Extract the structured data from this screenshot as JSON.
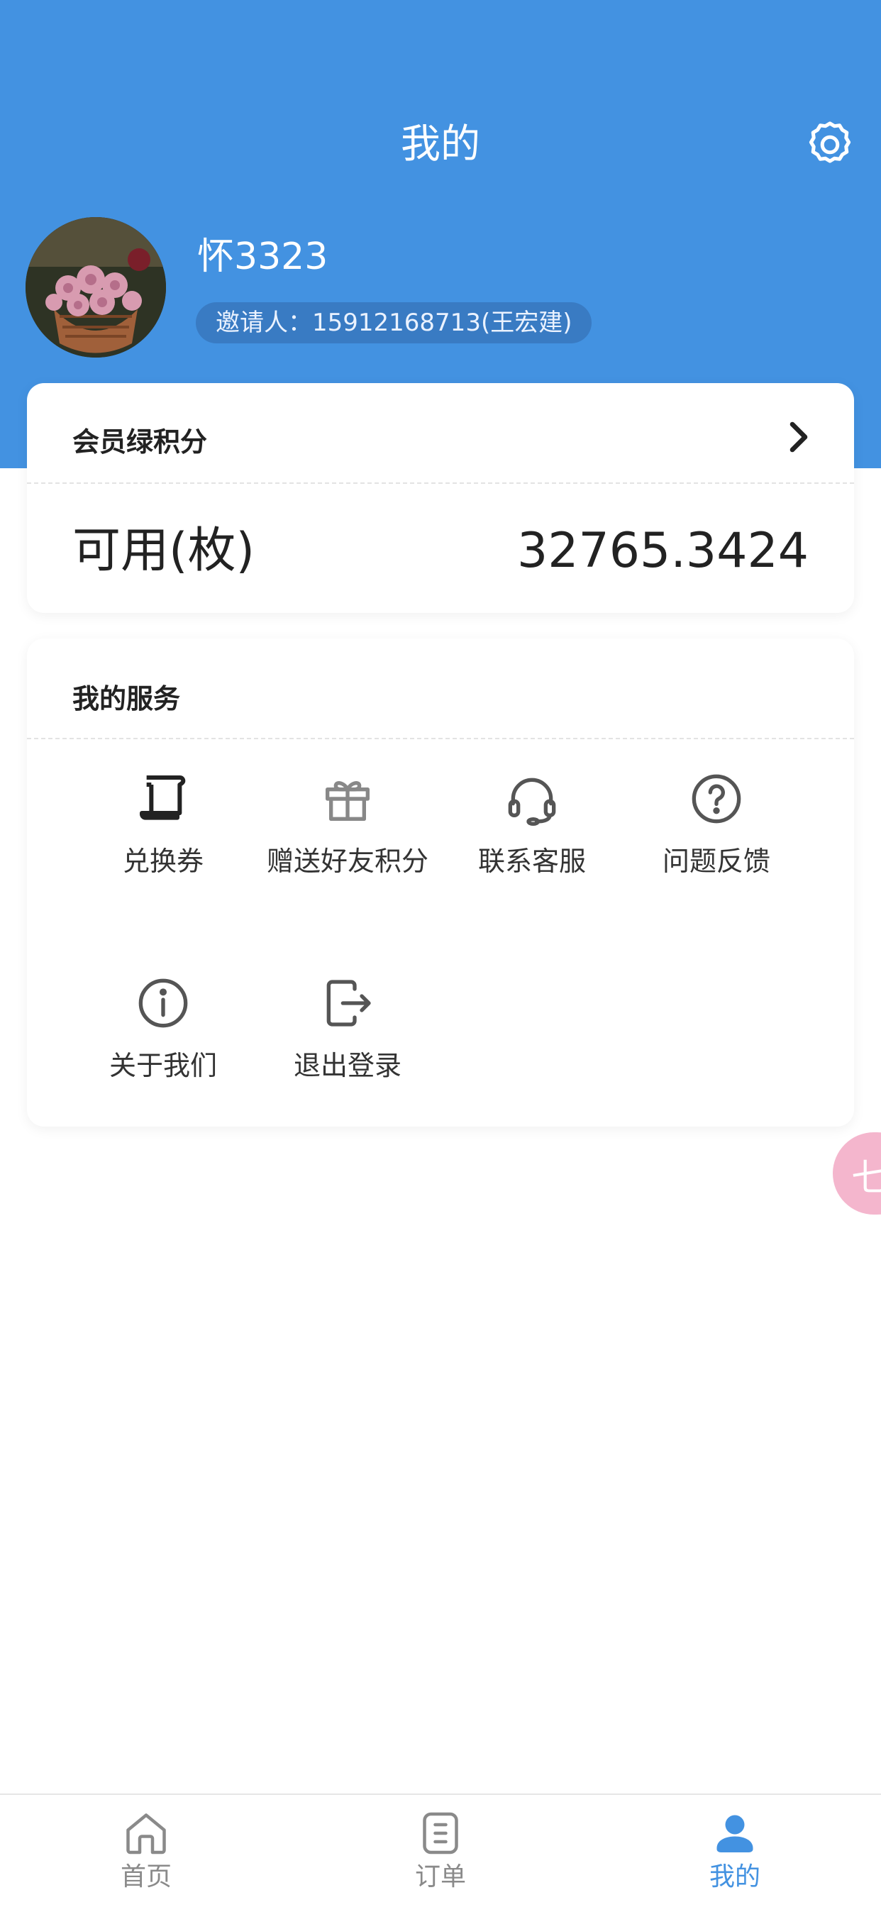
{
  "header": {
    "title": "我的",
    "bg_color": "#4392e1",
    "settings_icon": "gear-icon"
  },
  "profile": {
    "username": "怀3323",
    "inviter": "邀请人：15912168713(王宏建)",
    "avatar": "flower-basket-photo"
  },
  "points_card": {
    "title": "会员绿积分",
    "available_label": "可用(枚)",
    "available_value": "32765.3424"
  },
  "services": {
    "title": "我的服务",
    "items": [
      {
        "label": "兑换券",
        "icon": "coupon-icon"
      },
      {
        "label": "赠送好友积分",
        "icon": "gift-icon"
      },
      {
        "label": "联系客服",
        "icon": "headset-icon"
      },
      {
        "label": "问题反馈",
        "icon": "question-icon"
      },
      {
        "label": "关于我们",
        "icon": "info-icon"
      },
      {
        "label": "退出登录",
        "icon": "logout-icon"
      }
    ]
  },
  "floating_bubble": {
    "text": "七"
  },
  "tabbar": {
    "items": [
      {
        "label": "首页",
        "icon": "home-icon",
        "active": false
      },
      {
        "label": "订单",
        "icon": "order-icon",
        "active": false
      },
      {
        "label": "我的",
        "icon": "user-icon",
        "active": true
      }
    ],
    "active_color": "#4392e1"
  }
}
